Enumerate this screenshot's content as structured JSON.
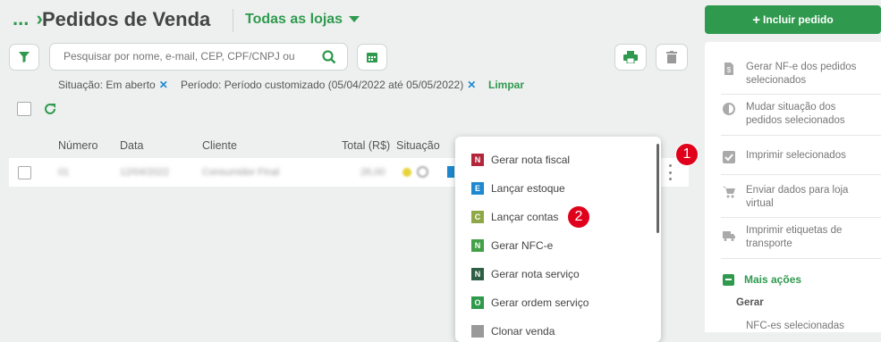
{
  "header": {
    "breadcrumb_dots": "...",
    "title": "Pedidos de Venda",
    "store_filter": "Todas as lojas"
  },
  "search": {
    "placeholder": "Pesquisar por nome, e-mail, CEP, CPF/CNPJ ou"
  },
  "filters": {
    "situacao": "Situação: Em aberto",
    "periodo": "Período: Período customizado (05/04/2022 até 05/05/2022)",
    "clear": "Limpar"
  },
  "table": {
    "columns": [
      "Número",
      "Data",
      "Cliente",
      "Total (R$)",
      "Situação"
    ],
    "rows": [
      {
        "numero": "01",
        "data": "12/04/2022",
        "cliente": "Consumidor Final",
        "total": "26,00"
      }
    ]
  },
  "context_menu": {
    "items": [
      {
        "badge": "N",
        "label": "Gerar nota fiscal",
        "color": "#b3263a"
      },
      {
        "badge": "E",
        "label": "Lançar estoque",
        "color": "#1e88d0"
      },
      {
        "badge": "C",
        "label": "Lançar contas",
        "color": "#8fa847"
      },
      {
        "badge": "N",
        "label": "Gerar NFC-e",
        "color": "#43a047"
      },
      {
        "badge": "N",
        "label": "Gerar nota serviço",
        "color": "#2e5e43"
      },
      {
        "badge": "O",
        "label": "Gerar ordem serviço",
        "color": "#2e9a4a"
      },
      {
        "badge": "",
        "label": "Clonar venda",
        "color": "#999999"
      }
    ]
  },
  "sidebar": {
    "include_button": "Incluir pedido",
    "items": [
      {
        "icon": "file-dollar-icon",
        "label": "Gerar NF-e dos pedidos selecionados"
      },
      {
        "icon": "half-circle-icon",
        "label": "Mudar situação dos pedidos selecionados"
      },
      {
        "icon": "checkbox-icon",
        "label": "Imprimir selecionados"
      },
      {
        "icon": "cart-icon",
        "label": "Enviar dados para loja virtual"
      },
      {
        "icon": "truck-icon",
        "label": "Imprimir etiquetas de transporte"
      }
    ],
    "more_actions": "Mais ações",
    "section_gerar": "Gerar",
    "sub_item": "NFC-es selecionadas"
  },
  "annotations": {
    "one": "1",
    "two": "2"
  },
  "colors": {
    "accent": "#2f9a4e",
    "annotation": "#e0001b"
  }
}
